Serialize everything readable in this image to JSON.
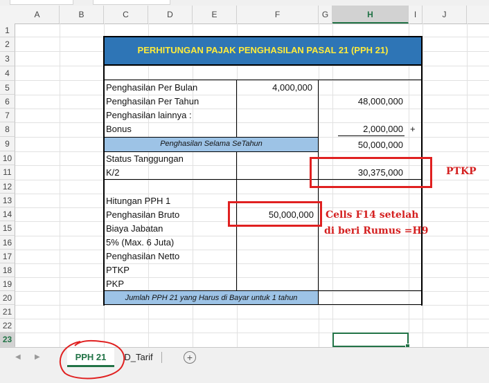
{
  "columns": [
    "A",
    "B",
    "C",
    "D",
    "E",
    "F",
    "G",
    "H",
    "I",
    "J"
  ],
  "selected_column": "H",
  "rows": [
    "1",
    "2",
    "3",
    "4",
    "5",
    "6",
    "7",
    "8",
    "9",
    "10",
    "11",
    "12",
    "13",
    "14",
    "15",
    "16",
    "17",
    "18",
    "19",
    "20",
    "21",
    "22",
    "23"
  ],
  "selected_row": "23",
  "title": "PERHITUNGAN PAJAK PENGHASILAN PASAL 21 (PPH 21)",
  "labels": {
    "r5": "Penghasilan Per Bulan",
    "r6": "Penghasilan Per Tahun",
    "r7": "Penghasilan lainnya :",
    "r8": "Bonus",
    "r9": "Penghasilan Selama SeTahun",
    "r10": "Status Tanggungan",
    "r11": "K/2",
    "r13": "Hitungan PPH 1",
    "r14": "Penghasilan Bruto",
    "r15": "Biaya Jabatan",
    "r16": "5% (Max. 6 Juta)",
    "r17": "Penghasilan Netto",
    "r18": "PTKP",
    "r19": "PKP",
    "r20": "Jumlah PPH 21 yang Harus di Bayar untuk 1 tahun"
  },
  "values": {
    "f5": "4,000,000",
    "h6": "48,000,000",
    "h8": "2,000,000",
    "plus": "+",
    "h9": "50,000,000",
    "h11": "30,375,000",
    "f14": "50,000,000"
  },
  "annotations": {
    "ptkp": "PTKP",
    "note_line1": "Cells F14 setelah",
    "note_line2": "di beri Rumus =H9",
    "accent": "#e02020"
  },
  "sheet_tabs": [
    {
      "label": "PPH 21",
      "active": true
    },
    {
      "label": "D_Tarif",
      "active": false
    }
  ],
  "add_sheet_icon": "+",
  "nav_icons": [
    "◀",
    "▶"
  ]
}
